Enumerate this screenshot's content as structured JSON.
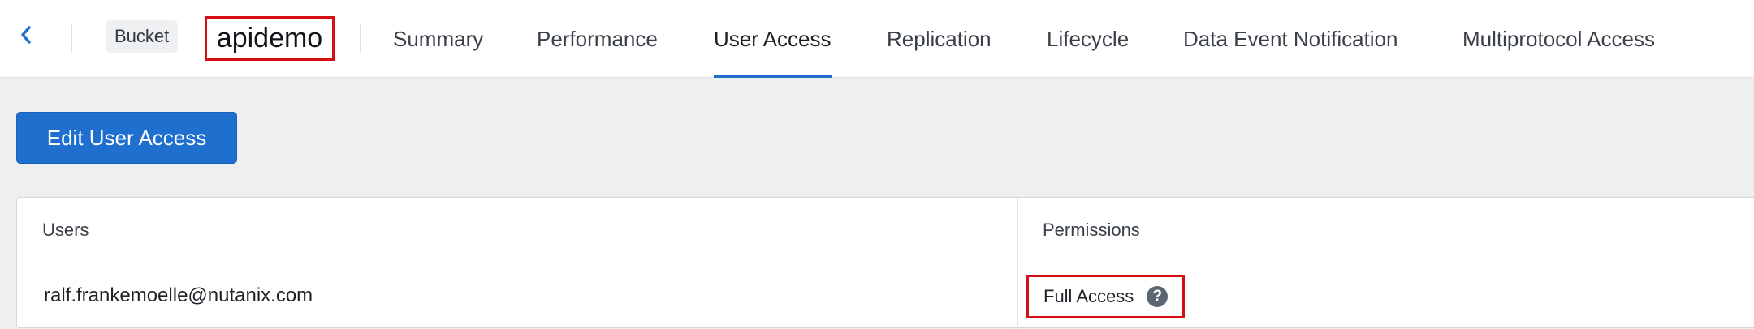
{
  "header": {
    "back_icon": "chevron-left-icon",
    "badge": "Bucket",
    "bucket_name": "apidemo",
    "tabs": [
      {
        "label": "Summary",
        "active": false
      },
      {
        "label": "Performance",
        "active": false
      },
      {
        "label": "User Access",
        "active": true
      },
      {
        "label": "Replication",
        "active": false
      },
      {
        "label": "Lifecycle",
        "active": false
      },
      {
        "label": "Data Event Notification",
        "active": false
      },
      {
        "label": "Multiprotocol Access",
        "active": false
      }
    ]
  },
  "actions": {
    "edit_label": "Edit User Access"
  },
  "table": {
    "columns": [
      "Users",
      "Permissions"
    ],
    "rows": [
      {
        "user": "ralf.frankemoelle@nutanix.com",
        "permission": "Full Access"
      }
    ],
    "help_icon": "question-circle-icon"
  },
  "colors": {
    "accent": "#1f6fce",
    "highlight": "#d40e14",
    "background": "#eeeff1"
  }
}
